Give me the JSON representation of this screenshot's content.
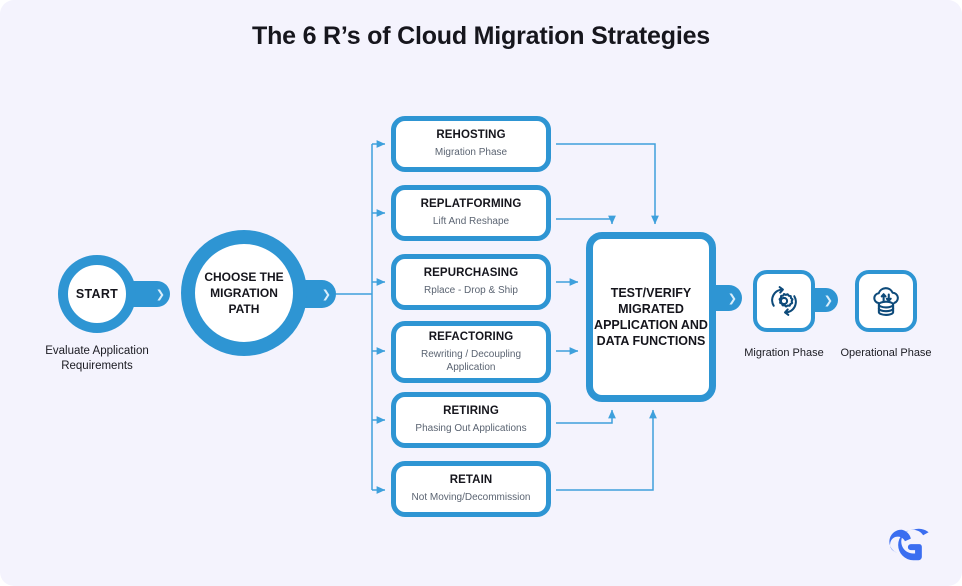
{
  "page": {
    "title": "The 6 R’s of Cloud Migration Strategies",
    "background_color": "#f4f3fd",
    "accent_color": "#2e95d3",
    "connector_color": "#3ea0dc",
    "icon_color": "#0d4a7a",
    "logo_color": "#3b6ef0"
  },
  "start": {
    "label": "START",
    "caption": "Evaluate Application Requirements",
    "chevron": "chevron-right-icon"
  },
  "decision": {
    "label": "CHOOSE THE MIGRATION PATH",
    "chevron": "chevron-right-icon"
  },
  "strategies": [
    {
      "title": "REHOSTING",
      "subtitle": "Migration Phase"
    },
    {
      "title": "REPLATFORMING",
      "subtitle": "Lift And Reshape"
    },
    {
      "title": "REPURCHASING",
      "subtitle": "Rplace - Drop & Ship"
    },
    {
      "title": "REFACTORING",
      "subtitle": "Rewriting / Decoupling Application"
    },
    {
      "title": "RETIRING",
      "subtitle": "Phasing Out Applications"
    },
    {
      "title": "RETAIN",
      "subtitle": "Not Moving/Decommission"
    }
  ],
  "center": {
    "label": "TEST/VERIFY MIGRATED APPLICATION AND DATA FUNCTIONS",
    "chevron": "chevron-right-icon"
  },
  "phases": [
    {
      "caption": "Migration Phase",
      "icon": "gear-refresh-icon",
      "chevron": "chevron-right-icon"
    },
    {
      "caption": "Operational Phase",
      "icon": "cloud-database-sync-icon"
    }
  ],
  "logo": {
    "name": "cloud-g-logo"
  }
}
